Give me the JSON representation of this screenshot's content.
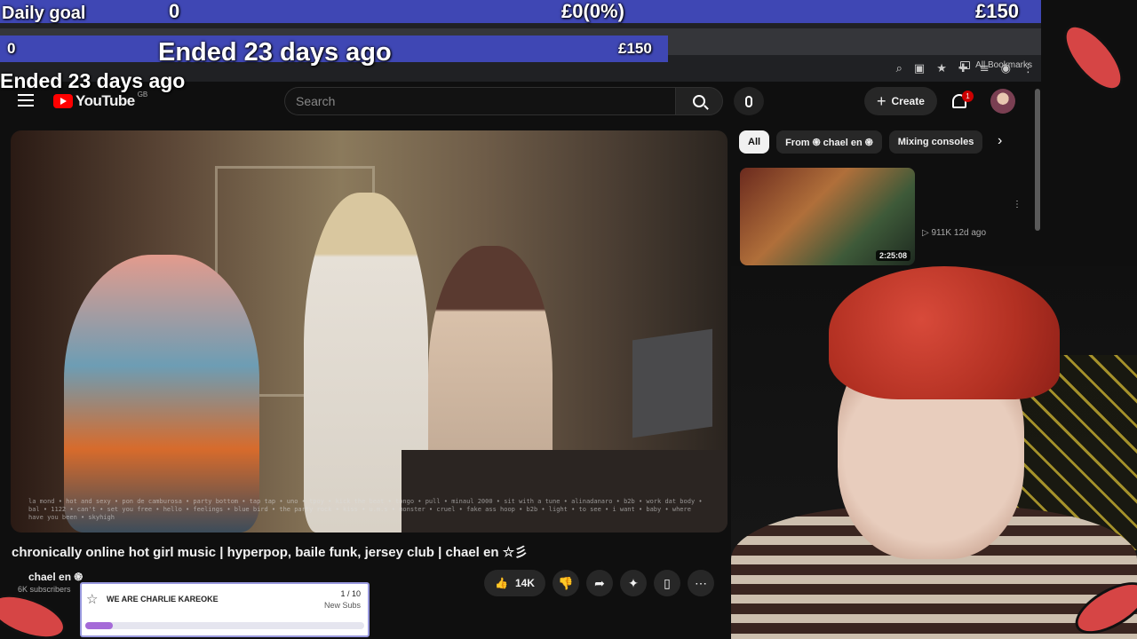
{
  "stream_overlay": {
    "goal_label": "Daily goal",
    "goal_current": "0",
    "goal_progress": "£0(0%)",
    "goal_target": "£150",
    "goal_ended": "Ended 23 days ago"
  },
  "browser": {
    "bookmarks_label": "All Bookmarks"
  },
  "header": {
    "logo_text": "YouTube",
    "region": "GB",
    "search_placeholder": "Search",
    "create_label": "Create",
    "notification_count": "1"
  },
  "video": {
    "title": "chronically online hot girl music | hyperpop, baile funk, jersey club | chael en ☆彡",
    "channel": "chael en ֍",
    "subscribers": "6K subscribers",
    "likes": "14K",
    "caption_text": "la mond • hot and sexy • pon de camburosa • party bottom • tap tap • uno • tpoy • kick the beat • tongo • pull • minaul 2000 • sit with a tune • alinadanaro • b2b • work dat body • bal • 1122 • can't • set you free • hello • feelings • blue bird • the party rock • kiss • u.m.s • monster • cruel • fake ass hoop • b2b • light • to see • i want • baby • where have you been • skyhigh"
  },
  "chips": [
    {
      "label": "All"
    },
    {
      "label": "From ֍ chael en ֍"
    },
    {
      "label": "Mixing consoles"
    }
  ],
  "recommendations": [
    {
      "duration": "2:25:08",
      "views": "911K",
      "age": "12d ago"
    }
  ],
  "sub_widget": {
    "title": "WE ARE CHARLIE KAREOKE",
    "count": "1 / 10",
    "label": "New Subs",
    "progress": 0.1
  },
  "colors": {
    "overlay_bar": "#3f47b4",
    "yt_red": "#ff0000",
    "progress_fill": "#a56ad8"
  }
}
